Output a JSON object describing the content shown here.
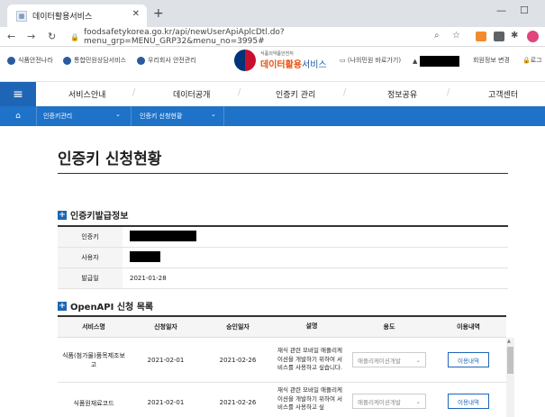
{
  "browser": {
    "tab_title": "데이터활용서비스",
    "url": "foodsafetykorea.go.kr/api/newUserApiAplcDtl.do?menu_grp=MENU_GRP32&menu_no=3995#"
  },
  "util": {
    "links": [
      "식품안전나라",
      "통합민원상담서비스",
      "우리회사 안전관리"
    ],
    "logo_small": "식품의약품안전처",
    "logo_main_a": "데이터활용",
    "logo_main_b": "서비스",
    "shortcut": "(나의민원 바로가기)",
    "member": "회원정보 변경",
    "logout": "로그"
  },
  "nav": {
    "items": [
      "서비스안내",
      "데이터공개",
      "인증키 관리",
      "정보공유",
      "고객센터"
    ]
  },
  "subnav": {
    "items": [
      "인증키관리",
      "인증키 신청현황"
    ]
  },
  "page": {
    "title": "인증키 신청현황"
  },
  "issue": {
    "heading": "인증키발급정보",
    "rows": [
      {
        "label": "인증키",
        "value": ""
      },
      {
        "label": "사용자",
        "value": ""
      },
      {
        "label": "발급일",
        "value": "2021-01-28"
      }
    ]
  },
  "openapi": {
    "heading": "OpenAPI 신청 목록",
    "headers": [
      "서비스명",
      "신청일자",
      "승인일자",
      "설명",
      "용도",
      "이용내역"
    ],
    "rows": [
      {
        "service": "식품(첨가물)품목제조보고",
        "applied": "2021-02-01",
        "approved": "2021-02-26",
        "desc": "재식 관련 모바일 애플리케이션을 개발하기 위하여 서비스를 사용하고 싶습니다.",
        "purpose": "애플리케이션개발",
        "button": "이용내역"
      },
      {
        "service": "식품원재료코드",
        "applied": "2021-02-01",
        "approved": "2021-02-26",
        "desc": "재식 관련 모바일 애플리케이션을 개발하기 위하여 서비스를 사용하고 싶",
        "purpose": "애플리케이션개발",
        "button": "이용내역"
      }
    ]
  }
}
